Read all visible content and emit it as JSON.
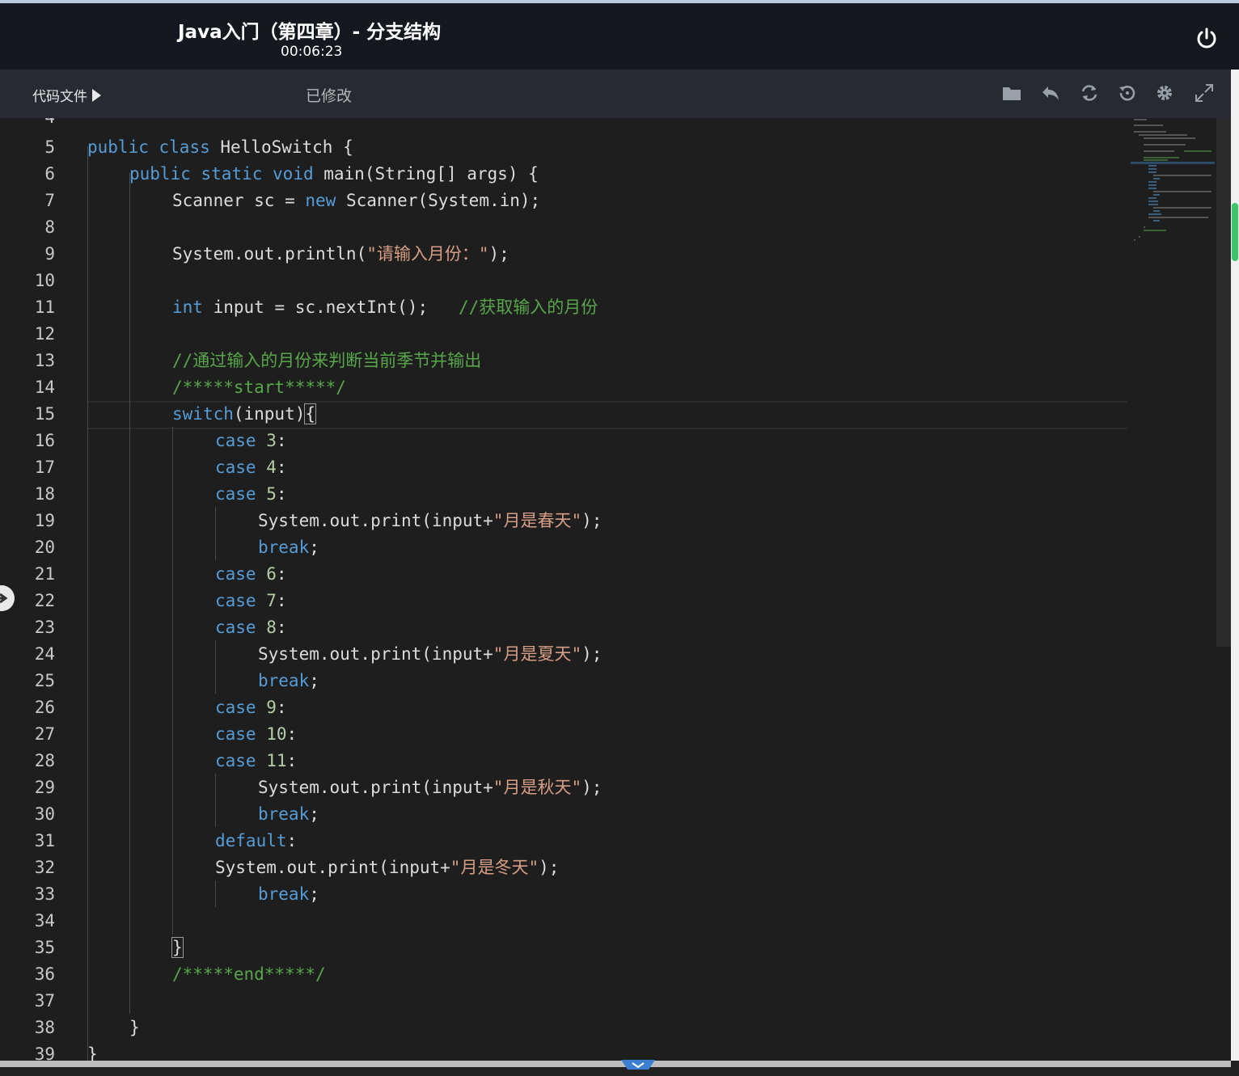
{
  "header": {
    "title": "Java入门（第四章）- 分支结构",
    "timer": "00:06:23",
    "power_icon": "power-icon"
  },
  "toolbar": {
    "code_files_label": "代码文件",
    "status": "已修改",
    "icons": [
      "folder-icon",
      "undo-icon",
      "refresh-icon",
      "history-icon",
      "gear-icon",
      "fullscreen-icon"
    ]
  },
  "editor": {
    "partial_top_line": "4",
    "lines": [
      {
        "n": "5"
      },
      {
        "n": "6"
      },
      {
        "n": "7"
      },
      {
        "n": "8"
      },
      {
        "n": "9"
      },
      {
        "n": "10"
      },
      {
        "n": "11"
      },
      {
        "n": "12"
      },
      {
        "n": "13"
      },
      {
        "n": "14"
      },
      {
        "n": "15"
      },
      {
        "n": "16"
      },
      {
        "n": "17"
      },
      {
        "n": "18"
      },
      {
        "n": "19"
      },
      {
        "n": "20"
      },
      {
        "n": "21"
      },
      {
        "n": "22"
      },
      {
        "n": "23"
      },
      {
        "n": "24"
      },
      {
        "n": "25"
      },
      {
        "n": "26"
      },
      {
        "n": "27"
      },
      {
        "n": "28"
      },
      {
        "n": "29"
      },
      {
        "n": "30"
      },
      {
        "n": "31"
      },
      {
        "n": "32"
      },
      {
        "n": "33"
      },
      {
        "n": "34"
      },
      {
        "n": "35"
      },
      {
        "n": "36"
      },
      {
        "n": "37"
      },
      {
        "n": "38"
      },
      {
        "n": "39"
      }
    ],
    "code": {
      "l5": [
        "public",
        " ",
        "class",
        " HelloSwitch {"
      ],
      "l6": [
        "public",
        " ",
        "static",
        " ",
        "void",
        " main(String[] args) {"
      ],
      "l7": [
        "Scanner sc = ",
        "new",
        " Scanner(System.in);"
      ],
      "l9": [
        "System.out.println(",
        "\"请输入月份：\"",
        ");"
      ],
      "l11": [
        "int",
        " input = sc.nextInt();   ",
        "//获取输入的月份"
      ],
      "l13": [
        "//通过输入的月份来判断当前季节并输出"
      ],
      "l14": [
        "/*****start*****/"
      ],
      "l15": [
        "switch",
        "(input)",
        "{"
      ],
      "l16": [
        "case",
        " ",
        "3",
        ":"
      ],
      "l17": [
        "case",
        " ",
        "4",
        ":"
      ],
      "l18": [
        "case",
        " ",
        "5",
        ":"
      ],
      "l19": [
        "System.out.print(input+",
        "\"月是春天\"",
        ");"
      ],
      "l20": [
        "break",
        ";"
      ],
      "l21": [
        "case",
        " ",
        "6",
        ":"
      ],
      "l22": [
        "case",
        " ",
        "7",
        ":"
      ],
      "l23": [
        "case",
        " ",
        "8",
        ":"
      ],
      "l24": [
        "System.out.print(input+",
        "\"月是夏天\"",
        ");"
      ],
      "l25": [
        "break",
        ";"
      ],
      "l26": [
        "case",
        " ",
        "9",
        ":"
      ],
      "l27": [
        "case",
        " ",
        "10",
        ":"
      ],
      "l28": [
        "case",
        " ",
        "11",
        ":"
      ],
      "l29": [
        "System.out.print(input+",
        "\"月是秋天\"",
        ");"
      ],
      "l30": [
        "break",
        ";"
      ],
      "l31": [
        "default",
        ":"
      ],
      "l32": [
        "System.out.print(input+",
        "\"月是冬天\"",
        ");"
      ],
      "l33": [
        "break",
        ";"
      ],
      "l35": [
        "}"
      ],
      "l36": [
        "/*****end*****/"
      ],
      "l38": [
        "}"
      ],
      "l39": [
        "}"
      ]
    }
  },
  "colors": {
    "background": "#1e1e1e",
    "keyword": "#569cd6",
    "string": "#d69d85",
    "comment": "#57a64a",
    "scroll_thumb": "#3ec26a"
  }
}
